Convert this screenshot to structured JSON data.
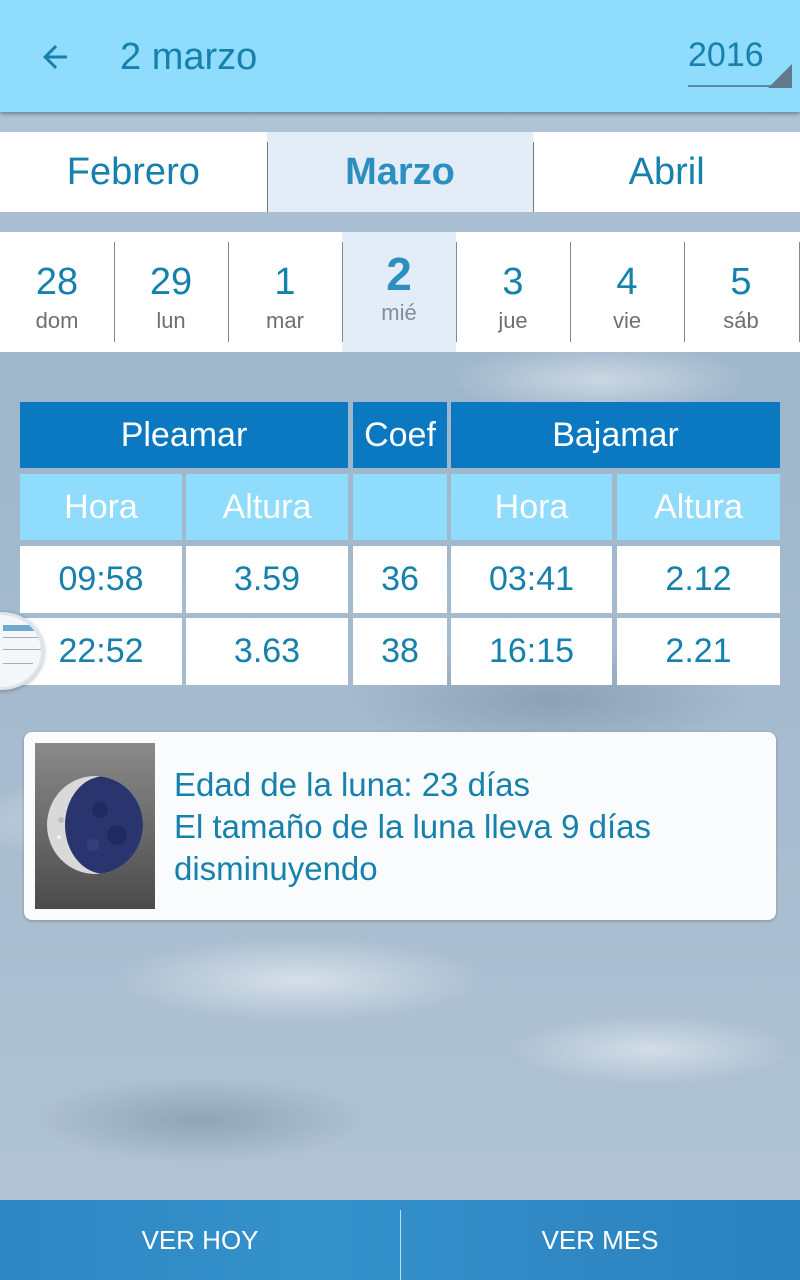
{
  "appbar": {
    "back_icon": "arrow-left-icon",
    "title": "2 marzo",
    "year": "2016"
  },
  "months": [
    {
      "label": "Febrero",
      "selected": false
    },
    {
      "label": "Marzo",
      "selected": true
    },
    {
      "label": "Abril",
      "selected": false
    }
  ],
  "days": [
    {
      "num": "28",
      "dow": "dom",
      "selected": false
    },
    {
      "num": "29",
      "dow": "lun",
      "selected": false
    },
    {
      "num": "1",
      "dow": "mar",
      "selected": false
    },
    {
      "num": "2",
      "dow": "mié",
      "selected": true
    },
    {
      "num": "3",
      "dow": "jue",
      "selected": false
    },
    {
      "num": "4",
      "dow": "vie",
      "selected": false
    },
    {
      "num": "5",
      "dow": "sáb",
      "selected": false
    }
  ],
  "tide_table": {
    "headers": {
      "pleamar": "Pleamar",
      "coef": "Coef",
      "bajamar": "Bajamar"
    },
    "subheaders": {
      "pleamar_hora": "Hora",
      "pleamar_altura": "Altura",
      "coef": "",
      "bajamar_hora": "Hora",
      "bajamar_altura": "Altura"
    },
    "rows": [
      {
        "pleamar_hora": "09:58",
        "pleamar_altura": "3.59",
        "coef": "36",
        "bajamar_hora": "03:41",
        "bajamar_altura": "2.12"
      },
      {
        "pleamar_hora": "22:52",
        "pleamar_altura": "3.63",
        "coef": "38",
        "bajamar_hora": "16:15",
        "bajamar_altura": "2.21"
      }
    ]
  },
  "moon": {
    "icon": "moon-phase-icon",
    "line1": "Edad de la luna: 23 días",
    "line2": "El tamaño de la luna lleva 9 días",
    "line3": "disminuyendo"
  },
  "bottom_bar": {
    "today_label": "VER HOY",
    "month_label": "VER MES"
  },
  "colors": {
    "appbar": "#8fdcfc",
    "accent_text": "#1581ac",
    "header_dark": "#0b78c2",
    "header_light": "#8fdcfc",
    "selected_bg": "#e3edf8",
    "bottom_bar": "#2d86c2"
  }
}
